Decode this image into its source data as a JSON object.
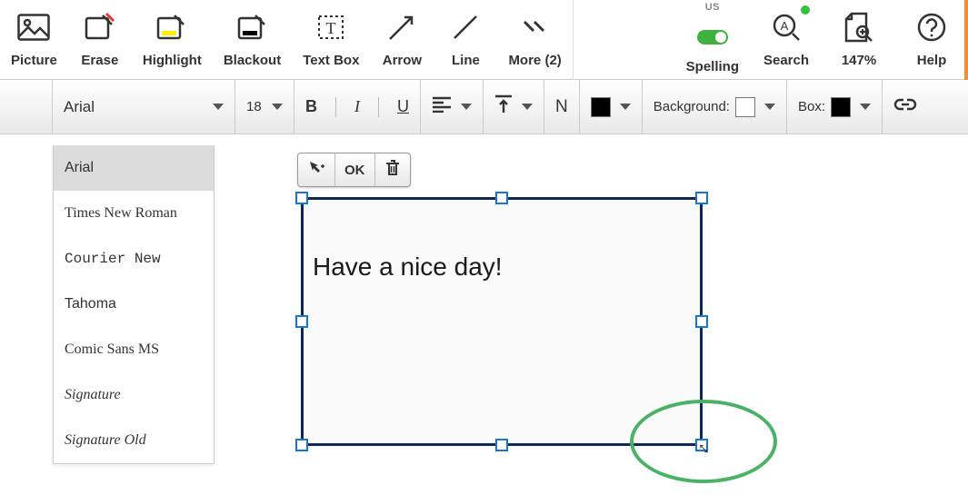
{
  "toolbar": {
    "picture": "Picture",
    "erase": "Erase",
    "highlight": "Highlight",
    "blackout": "Blackout",
    "textbox": "Text Box",
    "arrow": "Arrow",
    "line": "Line",
    "more": "More (2)",
    "spelling": "Spelling",
    "spelling_lang": "US",
    "search": "Search",
    "zoom": "147%",
    "help": "Help"
  },
  "format": {
    "font_name": "Arial",
    "font_size": "18",
    "n_label": "N",
    "background_label": "Background:",
    "box_label": "Box:",
    "text_color": "#000000",
    "background_color": "#ffffff",
    "box_color": "#000000",
    "font_list": [
      "Arial",
      "Times New Roman",
      "Courier New",
      "Tahoma",
      "Comic Sans MS",
      "Signature",
      "Signature Old"
    ]
  },
  "mini": {
    "ok": "OK"
  },
  "textbox_content": "Have a nice day!"
}
